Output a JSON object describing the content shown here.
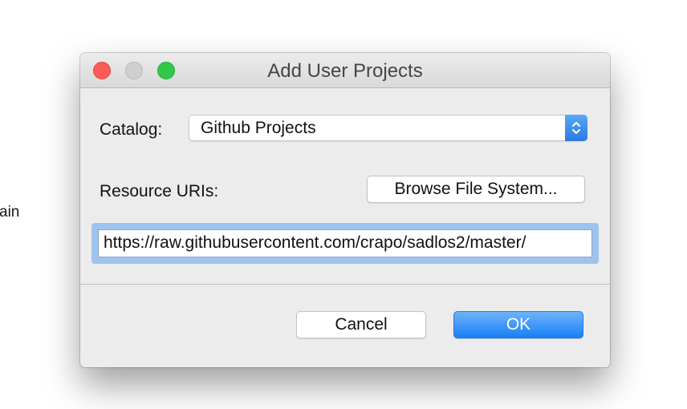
{
  "background": {
    "partial_text": "ain"
  },
  "dialog": {
    "title": "Add User Projects",
    "catalog_label": "Catalog:",
    "catalog_selected": "Github Projects",
    "resource_uris_label": "Resource URIs:",
    "browse_button": "Browse File System...",
    "resource_uri_value": "https://raw.githubusercontent.com/crapo/sadlos2/master/",
    "cancel_button": "Cancel",
    "ok_button": "OK"
  },
  "colors": {
    "close": "#fc5c55",
    "minimize": "#cfcfcf",
    "maximize": "#34c84a",
    "accent": "#1a7ff5",
    "focus_ring": "#9ec3ee"
  },
  "icons": {
    "window_close": "close-icon",
    "window_minimize": "minimize-icon",
    "window_maximize": "maximize-icon",
    "select_arrows": "updown-chevron-icon"
  }
}
